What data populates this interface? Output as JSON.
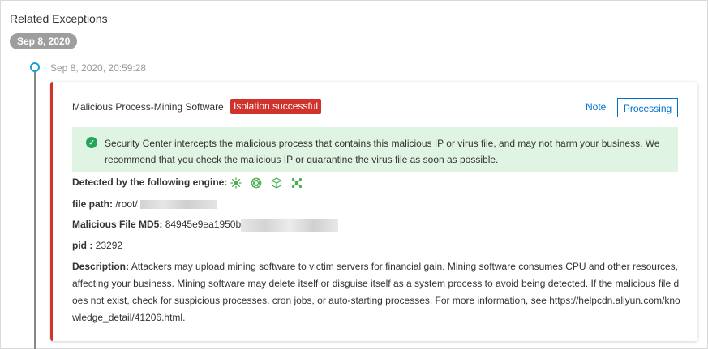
{
  "section_title": "Related Exceptions",
  "date_badge": "Sep 8, 2020",
  "timeline": {
    "timestamp": "Sep 8, 2020, 20:59:28"
  },
  "card": {
    "title": "Malicious Process-Mining Software",
    "status_tag": "Isolation successful",
    "note_label": "Note",
    "processing_label": "Processing",
    "info_message": "Security Center intercepts the malicious process that contains this malicious IP or virus file, and may not harm your business. We recommend that you check the malicious IP or quarantine the virus file as soon as possible.",
    "engine_label": "Detected by the following engine:",
    "engine_icons": [
      "virus-engine-icon",
      "intelligence-engine-icon",
      "sandbox-engine-icon",
      "network-engine-icon"
    ],
    "file_path_label": "file path:",
    "file_path_value": "/root/.",
    "md5_label": "Malicious File MD5:",
    "md5_value": "84945e9ea1950b",
    "pid_label": "pid :",
    "pid_value": "23292",
    "description_label": "Description:",
    "description_text": "Attackers may upload mining software to victim servers for financial gain. Mining software consumes CPU and other resources, affecting your business. Mining software may delete itself or disguise itself as a system process to avoid being detected. If the malicious file does not exist, check for suspicious processes, cron jobs, or auto-starting processes. For more information, see https://helpcdn.aliyun.com/knowledge_detail/41206.html."
  },
  "colors": {
    "accent_red": "#d0332b",
    "link_blue": "#0070cc",
    "success_green": "#22a75a",
    "info_bg": "#e0f4e4",
    "timeline_dot": "#14a0d6"
  }
}
